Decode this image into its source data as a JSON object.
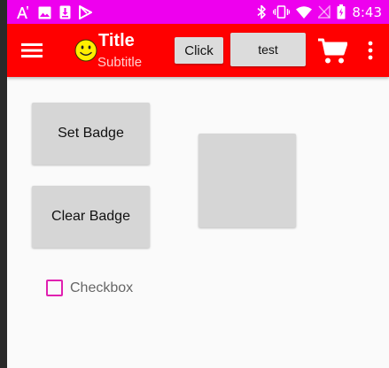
{
  "status_bar": {
    "time": "8:43",
    "left_icons": [
      "a-font-icon",
      "image-icon",
      "download-icon",
      "play-store-icon"
    ],
    "right_icons": [
      "bluetooth-icon",
      "vibrate-icon",
      "wifi-icon",
      "no-sim-icon",
      "battery-icon"
    ]
  },
  "app_bar": {
    "title": "Title",
    "subtitle": "Subtitle",
    "click_label": "Click",
    "test_label": "test",
    "color": "#ff0000"
  },
  "main": {
    "set_badge_label": "Set Badge",
    "clear_badge_label": "Clear Badge",
    "checkbox_label": "Checkbox",
    "checkbox_checked": false
  },
  "colors": {
    "status_bar": "#ee00ee",
    "accent": "#e020b0"
  }
}
